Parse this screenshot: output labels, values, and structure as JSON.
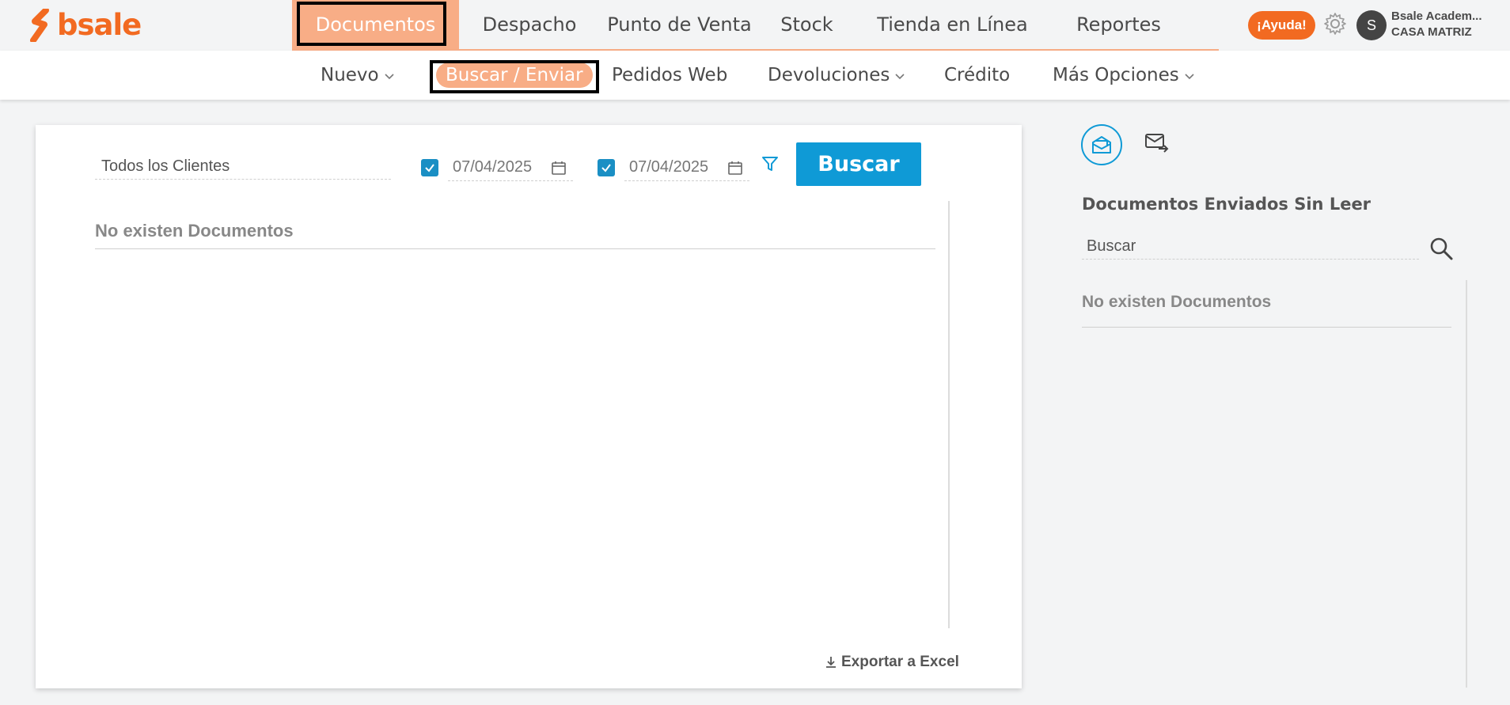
{
  "brand": {
    "logo_text": "bsale",
    "accent": "#f26a21",
    "nav_active_bg": "#f8ad86",
    "primary_blue": "#0f9ad6"
  },
  "main_nav": [
    "Documentos",
    "Despacho",
    "Punto de Venta",
    "Stock",
    "Tienda en Línea",
    "Reportes"
  ],
  "main_nav_active": "Documentos",
  "header": {
    "help_label": "¡Ayuda!",
    "avatar_initial": "S",
    "user_name": "Bsale Academ...",
    "branch": "CASA MATRIZ",
    "settings_icon": "gear-icon"
  },
  "sub_nav": {
    "nuevo": "Nuevo",
    "buscar_enviar": "Buscar / Enviar",
    "pedidos_web": "Pedidos Web",
    "devoluciones": "Devoluciones",
    "credito": "Crédito",
    "mas_opciones": "Más Opciones"
  },
  "filters": {
    "client_value": "Todos los Clientes",
    "date_from": "07/04/2025",
    "date_to": "07/04/2025",
    "date_from_checked": true,
    "date_to_checked": true,
    "search_button": "Buscar"
  },
  "results": {
    "empty_message": "No existen Documentos",
    "export_label": "Exportar a Excel"
  },
  "side_panel": {
    "title": "Documentos Enviados Sin Leer",
    "search_placeholder": "Buscar",
    "empty_message": "No existen Documentos"
  }
}
